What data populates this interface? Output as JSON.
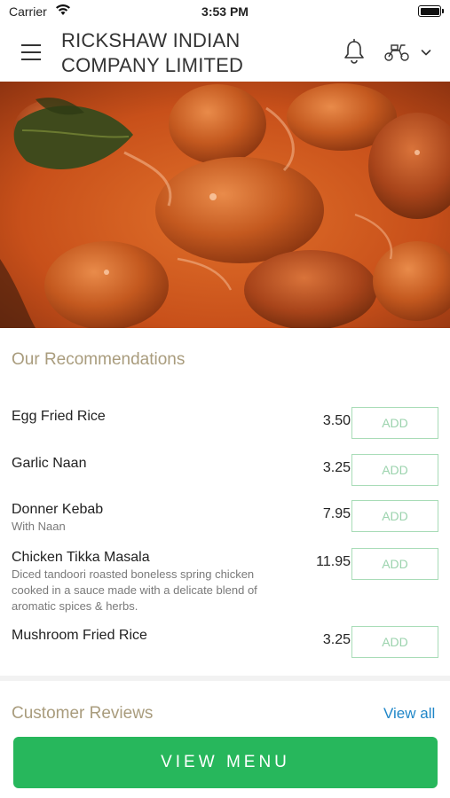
{
  "status_bar": {
    "carrier": "Carrier",
    "time": "3:53 PM"
  },
  "header": {
    "title": "RICKSHAW INDIAN COMPANY LIMITED",
    "icons": [
      "menu-icon",
      "bell-icon",
      "scooter-icon",
      "chevron-down-icon"
    ]
  },
  "hero": {
    "icon": "curry-image"
  },
  "recommendations": {
    "title": "Our Recommendations",
    "items": [
      {
        "name": "Egg Fried Rice",
        "description": "",
        "price": "3.50",
        "add_label": "ADD"
      },
      {
        "name": "Garlic Naan",
        "description": "",
        "price": "3.25",
        "add_label": "ADD"
      },
      {
        "name": "Donner Kebab",
        "description": "With Naan",
        "price": "7.95",
        "add_label": "ADD"
      },
      {
        "name": "Chicken Tikka Masala",
        "description": "Diced tandoori roasted boneless spring chicken cooked in a sauce made with a delicate blend of aromatic spices & herbs.",
        "price": "11.95",
        "add_label": "ADD"
      },
      {
        "name": "Mushroom Fried Rice",
        "description": "",
        "price": "3.25",
        "add_label": "ADD"
      }
    ]
  },
  "reviews": {
    "title": "Customer Reviews",
    "view_all": "View all"
  },
  "cta": {
    "label": "VIEW MENU"
  },
  "colors": {
    "accent_green": "#27b75c",
    "section_title": "#a99c7d",
    "link_blue": "#1f86c8",
    "add_border": "#a8dcb7"
  }
}
